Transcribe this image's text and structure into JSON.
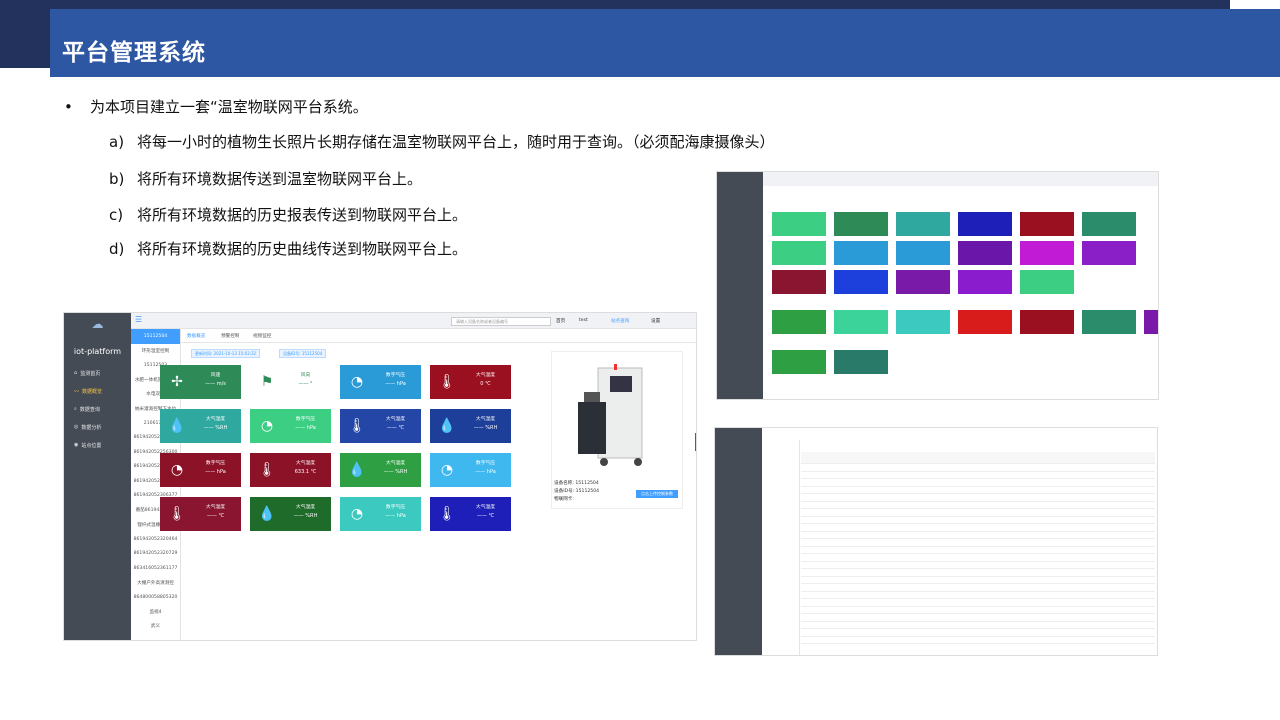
{
  "slide": {
    "title": "平台管理系统",
    "bullet": "为本项目建立一套“温室物联网平台系统。",
    "items": [
      {
        "n": "a)",
        "text": "将每一小时的植物生长照片长期存储在温室物联网平台上，随时用于查询。（必须配海康摄像头）"
      },
      {
        "n": "b)",
        "text": "将所有环境数据传送到温室物联网平台上。"
      },
      {
        "n": "c)",
        "text": "将所有环境数据的历史报表传送到物联网平台上。"
      },
      {
        "n": "d)",
        "text": "将所有环境数据的历史曲线传送到物联网平台上。"
      }
    ]
  },
  "app": {
    "brand": "iot-platform",
    "menu": [
      "监测首页",
      "数据概览",
      "数据查询",
      "数据分析",
      "站点位置"
    ],
    "search_placeholder": "请输入设备名称或者设备编号",
    "top_links": [
      "首页",
      "test",
      "站点查询",
      "设置"
    ],
    "tabs": [
      "数据概览",
      "预警控制",
      "视频监控"
    ],
    "chips": [
      "更新时间: 2021-10-13 15:03:32",
      "设备ID号: 15112504"
    ],
    "list": [
      "15112504",
      "环形温室控制",
      "15112503",
      "水肥一体机施肥测试",
      "水电双控",
      "纳米灌溉控制下水位",
      "21061703",
      "861942052284500",
      "861942052256300",
      "861942052300851",
      "861942052308232",
      "861942052306377",
      "番茄861942052...",
      "锂纤式温棚测试...",
      "861942052320464",
      "861942052320729",
      "863416052361177",
      "大棚户外高清测控",
      "864800058805320",
      "监视4",
      "武义"
    ],
    "cards": [
      {
        "name": "风速",
        "value": "—— m/s",
        "icon": "fan-icon",
        "glyph": "✢",
        "color": "#2e8b57"
      },
      {
        "name": "风向",
        "value": "—— °",
        "icon": "windsock-icon",
        "glyph": "⚑",
        "color": "#ffffff"
      },
      {
        "name": "数字气压",
        "value": "—— hPa",
        "icon": "gauge-icon",
        "glyph": "◔",
        "color": "#2b9bd8"
      },
      {
        "name": "大气温度",
        "value": "0 ℃",
        "icon": "thermometer-icon",
        "glyph": "🌡",
        "color": "#9b1020"
      },
      {
        "name": "大气湿度",
        "value": "—— %RH",
        "icon": "droplet-icon",
        "glyph": "💧",
        "color": "#2fa8a0"
      },
      {
        "name": "数字气压",
        "value": "—— hPa",
        "icon": "gauge-icon",
        "glyph": "◔",
        "color": "#3ccf84"
      },
      {
        "name": "大气温度",
        "value": "—— ℃",
        "icon": "thermometer-icon",
        "glyph": "🌡",
        "color": "#2346a7"
      },
      {
        "name": "大气湿度",
        "value": "—— %RH",
        "icon": "droplet-icon",
        "glyph": "💧",
        "color": "#1d3f99"
      },
      {
        "name": "数字气压",
        "value": "—— hPa",
        "icon": "gauge-icon",
        "glyph": "◔",
        "color": "#8c1228"
      },
      {
        "name": "大气温度",
        "value": "633.1 ℃",
        "icon": "thermometer-icon",
        "glyph": "🌡",
        "color": "#8c1228"
      },
      {
        "name": "大气温度",
        "value": "—— %RH",
        "icon": "droplet-icon",
        "glyph": "💧",
        "color": "#2ea043"
      },
      {
        "name": "数字气压",
        "value": "—— hPa",
        "icon": "gauge-icon",
        "glyph": "◔",
        "color": "#3fb8f0"
      },
      {
        "name": "大气温度",
        "value": "—— ℃",
        "icon": "thermometer-icon",
        "glyph": "🌡",
        "color": "#8a1530"
      },
      {
        "name": "大气湿度",
        "value": "—— %RH",
        "icon": "droplet-icon",
        "glyph": "💧",
        "color": "#1f6b2a"
      },
      {
        "name": "数字气压",
        "value": "—— hPa",
        "icon": "gauge-icon",
        "glyph": "◔",
        "color": "#3ccac0"
      },
      {
        "name": "大气温度",
        "value": "—— ℃",
        "icon": "thermometer-icon",
        "glyph": "🌡",
        "color": "#1d1fb8"
      }
    ],
    "device": {
      "name_label": "设备名称: 15112504",
      "id_label": "设备ID号: 15112504",
      "card_label": "物联网卡:",
      "button": "点击上传控制参数"
    }
  }
}
